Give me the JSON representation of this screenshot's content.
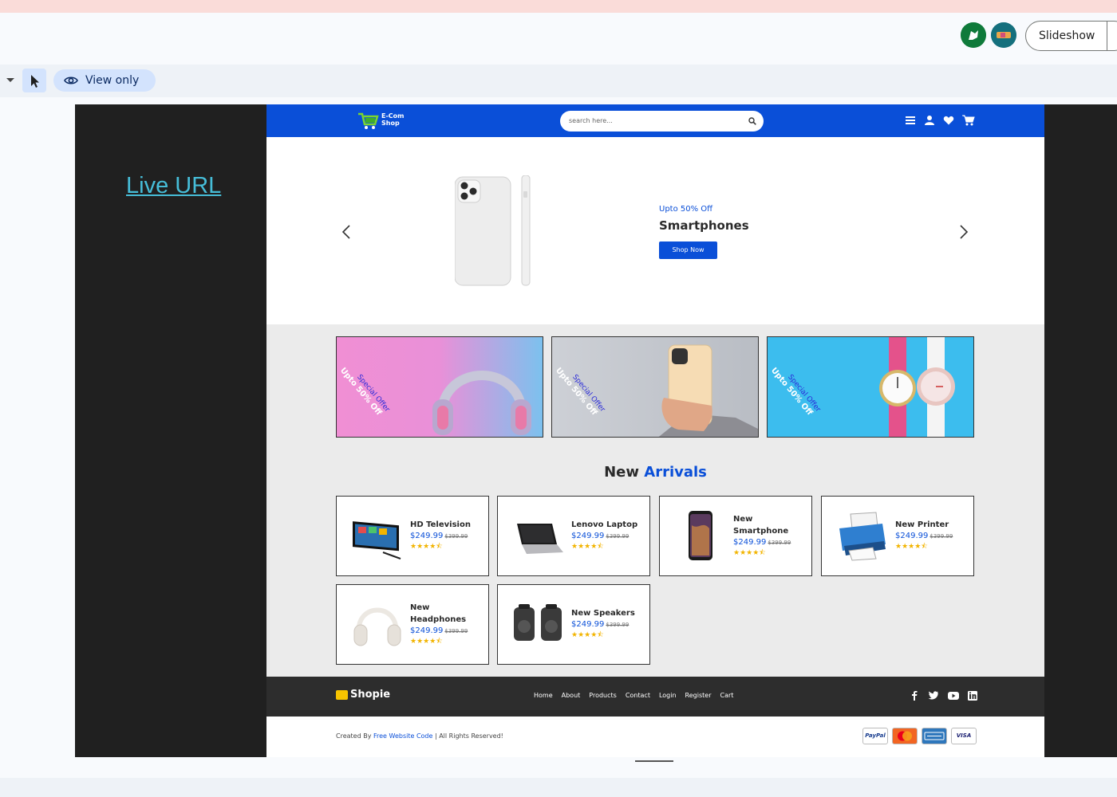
{
  "app": {
    "slideshow_label": "Slideshow",
    "view_only_label": "View only"
  },
  "slide": {
    "live_url_label": "Live URL"
  },
  "site": {
    "logo_line1": "E-Com",
    "logo_line2": "Shop",
    "search_placeholder": "search here...",
    "hero": {
      "subtitle": "Upto 50% Off",
      "title": "Smartphones",
      "button": "Shop Now"
    },
    "promos": [
      {
        "tag": "Special Offer",
        "text": "Upto 50% Off"
      },
      {
        "tag": "Special Offer",
        "text": "Upto 50% Off"
      },
      {
        "tag": "Special Offer",
        "text": "Upto 50% Off"
      }
    ],
    "arrivals": {
      "title_plain": "New",
      "title_accent": "Arrivals"
    },
    "products": [
      {
        "name": "HD Television",
        "price": "$249.99",
        "old_price": "$399.99",
        "stars": "★★★★⯪"
      },
      {
        "name": "Lenovo Laptop",
        "price": "$249.99",
        "old_price": "$399.99",
        "stars": "★★★★⯪"
      },
      {
        "name": "New Smartphone",
        "price": "$249.99",
        "old_price": "$399.99",
        "stars": "★★★★⯪"
      },
      {
        "name": "New Printer",
        "price": "$249.99",
        "old_price": "$399.99",
        "stars": "★★★★⯪"
      },
      {
        "name": "New Headphones",
        "price": "$249.99",
        "old_price": "$399.99",
        "stars": "★★★★⯪"
      },
      {
        "name": "New Speakers",
        "price": "$249.99",
        "old_price": "$399.99",
        "stars": "★★★★⯪"
      }
    ],
    "footer": {
      "brand": "Shopie",
      "links": [
        "Home",
        "About",
        "Products",
        "Contact",
        "Login",
        "Register",
        "Cart"
      ],
      "credits_prefix": "Created By",
      "credits_link": "Free Website Code",
      "credits_suffix": "| All Rights Reserved!",
      "payments": [
        "PayPal",
        "MasterCard",
        "AMERICAN EXPRESS",
        "VISA"
      ]
    }
  },
  "colors": {
    "brand_blue": "#0a4fd8",
    "star_gold": "#f2b400",
    "live_url": "#46bdd8"
  }
}
